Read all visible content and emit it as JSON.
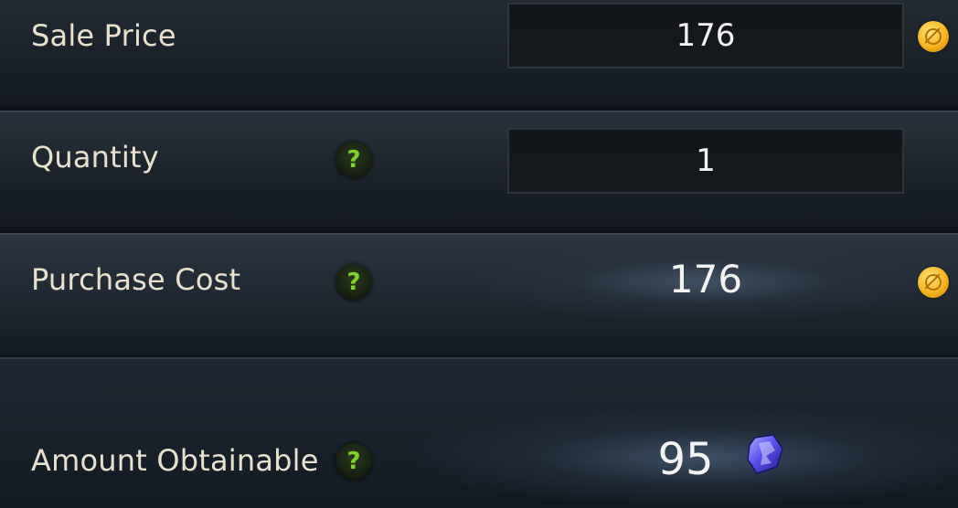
{
  "sale_price": {
    "label": "Sale Price",
    "value": "176",
    "currency_icon": "gold-coin-icon"
  },
  "quantity": {
    "label": "Quantity",
    "help_icon": "?",
    "value": "1"
  },
  "purchase_cost": {
    "label": "Purchase Cost",
    "help_icon": "?",
    "value": "176",
    "currency_icon": "gold-coin-icon"
  },
  "amount_obtainable": {
    "label": "Amount Obtainable",
    "help_icon": "?",
    "value": "95",
    "currency_icon": "blue-crystal-icon"
  },
  "colors": {
    "label_text": "#e9e1cf",
    "help_accent": "#7fd12c",
    "gold": "#f6b51f",
    "crystal": "#6b63ff"
  }
}
